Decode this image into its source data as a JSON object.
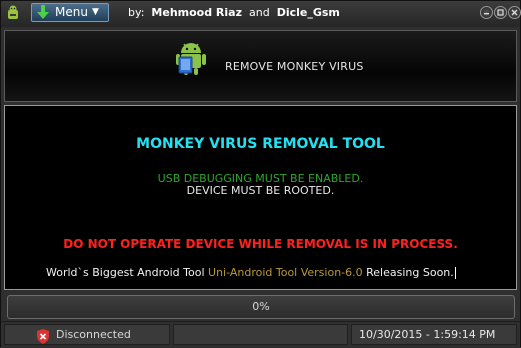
{
  "titlebar": {
    "menu_label": "Menu",
    "credits_prefix": "by:",
    "author1": "Mehmood Riaz",
    "and_text": "and",
    "author2": "Dicle_Gsm",
    "buttons": [
      "minimize-button",
      "maximize-button",
      "close-button"
    ]
  },
  "banner": {
    "title": "REMOVE MONKEY VIRUS"
  },
  "main": {
    "headline": "MONKEY VIRUS REMOVAL TOOL",
    "usb_line": "USB DEBUGGING MUST BE ENABLED.",
    "root_line": "DEVICE MUST BE ROOTED.",
    "warning": "DO NOT OPERATE DEVICE WHILE REMOVAL IS IN PROCESS.",
    "tagline_part1": "World`s Biggest Android Tool",
    "tagline_part2": "Uni-Android Tool Version-6.0",
    "tagline_part3": "Releasing Soon."
  },
  "progress": {
    "text": "0%",
    "value": 0
  },
  "status": {
    "connection": "Disconnected",
    "datetime": "10/30/2015  -  1:59:14 PM"
  },
  "colors": {
    "headline": "#24e0f0",
    "usb_line": "#2fa52f",
    "warning": "#ff2020",
    "tagline_highlight": "#b99a3a"
  }
}
